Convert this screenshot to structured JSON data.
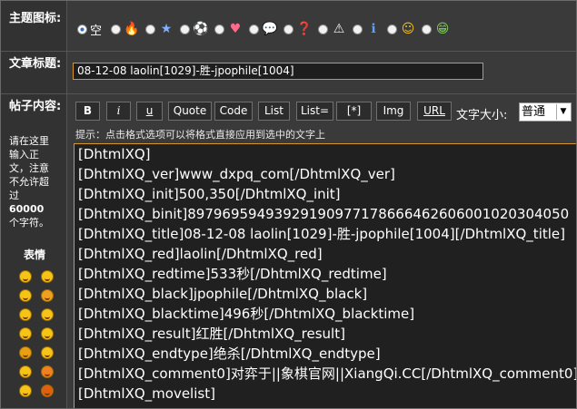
{
  "icon_row": {
    "label": "主题图标:",
    "empty_option": "空",
    "icons": [
      "flame-icon",
      "star-icon",
      "soccer-ball-icon",
      "heart-icon",
      "speech-bubble-icon",
      "question-icon",
      "warning-icon",
      "info-icon",
      "smiley-icon",
      "grin-icon"
    ],
    "glyphs": [
      "🔥",
      "★",
      "⚽",
      "♥",
      "💬",
      "❓",
      "⚠",
      "ℹ",
      "☺",
      "😁"
    ],
    "glyph_colors": [
      "#ff5a2a",
      "#7fb3ff",
      "#e6e6e6",
      "#ff6a8a",
      "#cfe0ff",
      "#5aa0ff",
      "#f0f0f0",
      "#5aa0ff",
      "#f5c417",
      "#7acc55"
    ]
  },
  "title_row": {
    "label": "文章标题:",
    "value": "08-12-08 laolin[1029]-胜-jpophile[1004]"
  },
  "content_row": {
    "label": "帖子内容:",
    "note": [
      "请在这里",
      "输入正",
      "文，注意",
      "不允许超",
      "过"
    ],
    "limit": "60000",
    "limit_suffix": "个字符。",
    "emoticons_label": "表情",
    "toolbar": [
      "B",
      "i",
      "u",
      "Quote",
      "Code",
      "List",
      "List=",
      "[*]",
      "Img",
      "URL"
    ],
    "font_size_label": "文字大小:",
    "font_size_value": "普通",
    "hint": "提示：点击格式选项可以将格式直接应用到选中的文字上",
    "lines": [
      "[DhtmlXQ]",
      "[DhtmlXQ_ver]www_dxpq_com[/DhtmlXQ_ver]",
      "[DhtmlXQ_init]500,350[/DhtmlXQ_init]",
      "[DhtmlXQ_binit]89796959493929190977178666462606001020304050",
      "[DhtmlXQ_title]08-12-08 laolin[1029]-胜-jpophile[1004][/DhtmlXQ_title]",
      "[DhtmlXQ_red]laolin[/DhtmlXQ_red]",
      "[DhtmlXQ_redtime]533秒[/DhtmlXQ_redtime]",
      "[DhtmlXQ_black]jpophile[/DhtmlXQ_black]",
      "[DhtmlXQ_blacktime]496秒[/DhtmlXQ_blacktime]",
      "[DhtmlXQ_result]红胜[/DhtmlXQ_result]",
      "[DhtmlXQ_endtype]绝杀[/DhtmlXQ_endtype]",
      "[DhtmlXQ_comment0]对弈于||象棋官网||XiangQi.CC[/DhtmlXQ_comment0]",
      "[DhtmlXQ_movelist]"
    ]
  }
}
